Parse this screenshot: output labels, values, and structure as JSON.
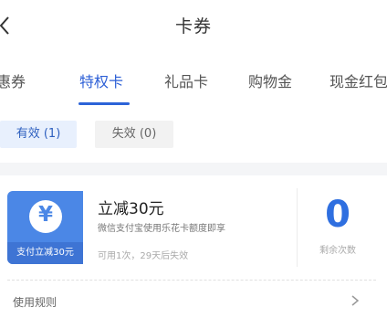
{
  "header": {
    "title": "卡券"
  },
  "tabs": [
    {
      "label": "优惠券",
      "active": false
    },
    {
      "label": "特权卡",
      "active": true
    },
    {
      "label": "礼品卡",
      "active": false
    },
    {
      "label": "购物金",
      "active": false
    },
    {
      "label": "现金红包",
      "active": false
    }
  ],
  "filters": {
    "valid_label": "有效 (1)",
    "invalid_label": "失效 (0)"
  },
  "card": {
    "icon": "yen-icon",
    "icon_glyph": "¥",
    "tag": "支付立减30元",
    "title": "立减30元",
    "description": "微信支付宝使用乐花卡额度即享",
    "meta": "可用1次，29天后失效",
    "count": "0",
    "count_label": "剩余次数",
    "rules_label": "使用规则"
  },
  "colors": {
    "accent": "#2c63d8",
    "card_blue": "#4b87e6",
    "card_tag": "#3e74d4",
    "chip_bg": "#e8f0fd"
  }
}
